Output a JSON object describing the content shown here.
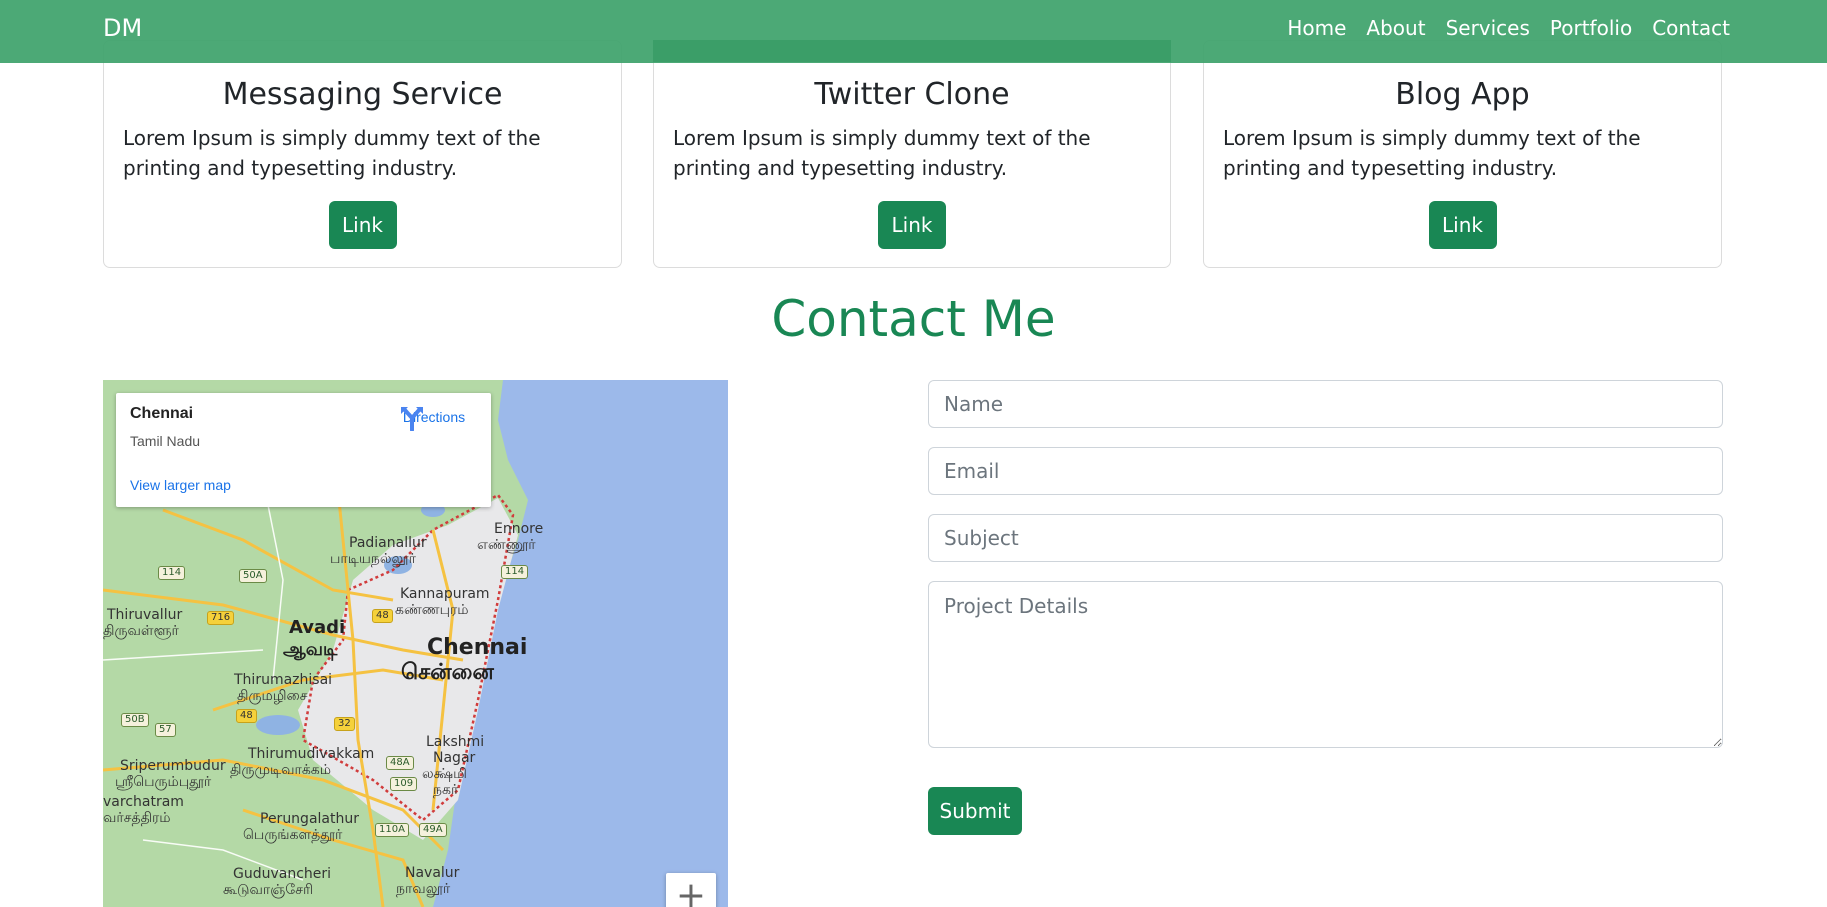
{
  "colors": {
    "brand_green": "#198754",
    "navbar_green": "#3ea36c"
  },
  "navbar": {
    "brand": "DM",
    "links": [
      "Home",
      "About",
      "Services",
      "Portfolio",
      "Contact"
    ]
  },
  "projects": [
    {
      "title": "Messaging Service",
      "text": "Lorem Ipsum is simply dummy text of the printing and typesetting industry.",
      "link_label": "Link"
    },
    {
      "title": "Twitter Clone",
      "text": "Lorem Ipsum is simply dummy text of the printing and typesetting industry.",
      "link_label": "Link"
    },
    {
      "title": "Blog App",
      "text": "Lorem Ipsum is simply dummy text of the printing and typesetting industry.",
      "link_label": "Link"
    }
  ],
  "contact": {
    "title": "Contact Me",
    "map": {
      "place": "Chennai",
      "region": "Tamil Nadu",
      "directions_label": "Directions",
      "larger_map_label": "View larger map",
      "zoom_in_label": "+",
      "labels": {
        "chennai": "Chennai",
        "chennai_ta": "சென்னை",
        "avadi": "Avadi",
        "avadi_ta": "ஆவடி",
        "ennore": "Ennore",
        "ennore_ta": "எண்ணூர்",
        "padianallur": "Padianallur",
        "padianallur_ta": "பாடியநல்லூர்",
        "kannapuram": "Kannapuram",
        "kannapuram_ta": "கண்ணபுரம்",
        "thiruvallur": "Thiruvallur",
        "thiruvallur_ta": "திருவள்ளூர்",
        "thirumazhisai": "Thirumazhisai",
        "thirumazhisai_ta": "திருமழிசை",
        "lakshmi_nagar": "Lakshmi",
        "lakshmi_nagar2": "Nagar",
        "lakshmi_ta": "லக்ஷ்மி",
        "lakshmi_ta2": "நகர்",
        "thirumudivakkam": "Thirumudivakkam",
        "thirumudivakkam_ta": "திருமுடிவாக்கம்",
        "sriperumbudur": "Sriperumbudur",
        "sriperumbudur_ta": "ஸ்ரீபெரும்புதூர்",
        "varchatram": "varchatram",
        "varchatram_ta": "வர்சத்திரம்",
        "perungalathur": "Perungalathur",
        "perungalathur_ta": "பெருங்களத்தூர்",
        "guduvancheri": "Guduvancheri",
        "guduvancheri_ta": "கூடுவாஞ்சேரி",
        "navalur": "Navalur",
        "navalur_ta": "நாவலூர்"
      },
      "shields": [
        "114",
        "50A",
        "716",
        "48",
        "114",
        "48",
        "32",
        "50B",
        "57",
        "48A",
        "109",
        "110A",
        "49A"
      ]
    },
    "form": {
      "name_placeholder": "Name",
      "email_placeholder": "Email",
      "subject_placeholder": "Subject",
      "details_placeholder": "Project Details",
      "submit_label": "Submit"
    }
  }
}
